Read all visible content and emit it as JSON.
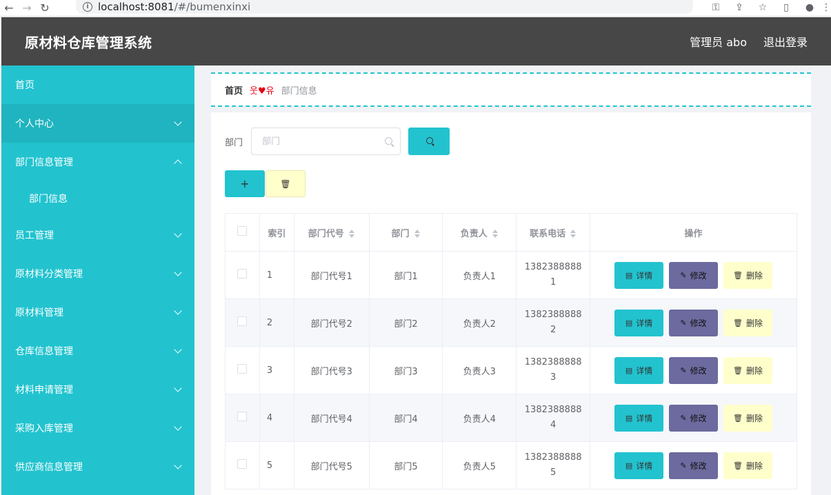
{
  "browser": {
    "url_host": "localhost:8081",
    "url_path": "/#/bumenxinxi"
  },
  "header": {
    "title": "原材料仓库管理系统",
    "user": "管理员 abo",
    "logout": "退出登录"
  },
  "sidebar": {
    "items": [
      {
        "label": "首页",
        "has_arrow": false
      },
      {
        "label": "个人中心",
        "has_arrow": true
      },
      {
        "label": "部门信息管理",
        "has_arrow": true,
        "expanded": true
      },
      {
        "label": "部门信息",
        "sub": true
      },
      {
        "label": "员工管理",
        "has_arrow": true
      },
      {
        "label": "原材料分类管理",
        "has_arrow": true
      },
      {
        "label": "原材料管理",
        "has_arrow": true
      },
      {
        "label": "仓库信息管理",
        "has_arrow": true
      },
      {
        "label": "材料申请管理",
        "has_arrow": true
      },
      {
        "label": "采购入库管理",
        "has_arrow": true
      },
      {
        "label": "供应商信息管理",
        "has_arrow": true
      }
    ]
  },
  "breadcrumb": {
    "home": "首页",
    "separator_left": "웃",
    "separator_right": "유",
    "current": "部门信息"
  },
  "search": {
    "label": "部门",
    "placeholder": "部门"
  },
  "table": {
    "headers": {
      "index": "索引",
      "code": "部门代号",
      "dept": "部门",
      "manager": "负责人",
      "phone": "联系电话",
      "ops": "操作"
    },
    "rows": [
      {
        "index": "1",
        "code": "部门代号1",
        "dept": "部门1",
        "manager": "负责人1",
        "phone_a": "1382388888",
        "phone_b": "1"
      },
      {
        "index": "2",
        "code": "部门代号2",
        "dept": "部门2",
        "manager": "负责人2",
        "phone_a": "1382388888",
        "phone_b": "2"
      },
      {
        "index": "3",
        "code": "部门代号3",
        "dept": "部门3",
        "manager": "负责人3",
        "phone_a": "1382388888",
        "phone_b": "3"
      },
      {
        "index": "4",
        "code": "部门代号4",
        "dept": "部门4",
        "manager": "负责人4",
        "phone_a": "1382388888",
        "phone_b": "4"
      },
      {
        "index": "5",
        "code": "部门代号5",
        "dept": "部门5",
        "manager": "负责人5",
        "phone_a": "1382388888",
        "phone_b": "5"
      }
    ],
    "actions": {
      "detail": "详情",
      "edit": "修改",
      "delete": "删除"
    }
  },
  "colors": {
    "accent": "#22c3cf",
    "header_bg": "#474747",
    "edit_btn": "#6c6a9e",
    "delete_btn": "#ffffcc",
    "breadcrumb_sep": "#e60012"
  }
}
